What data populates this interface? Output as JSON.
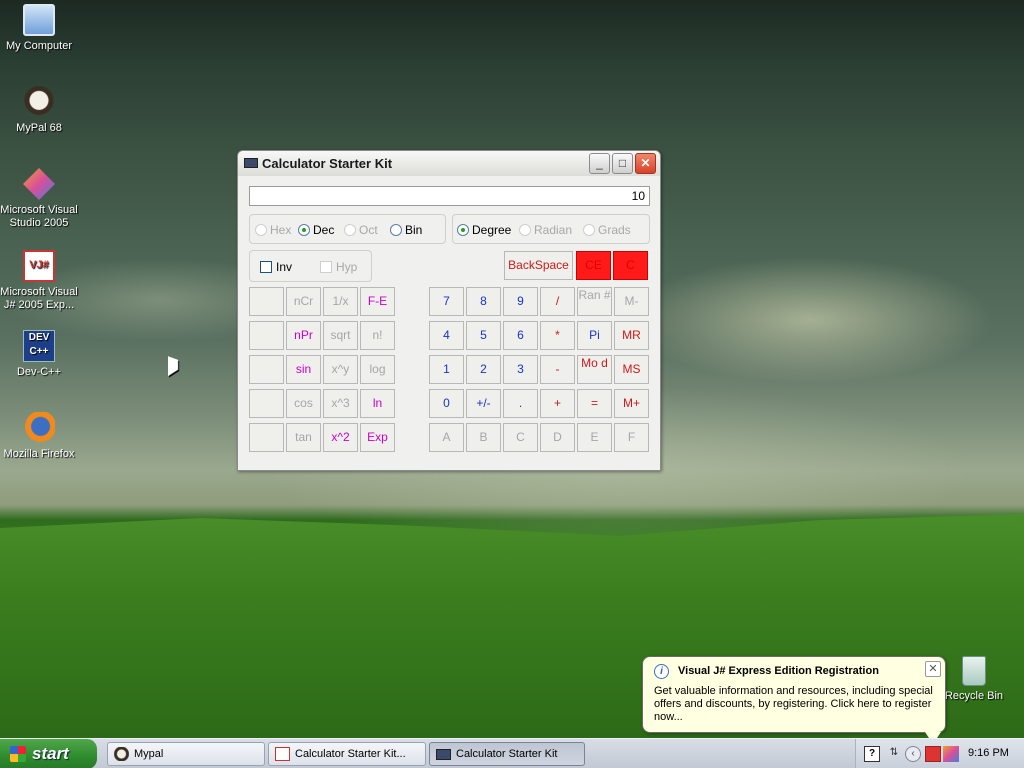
{
  "desktop": {
    "icons": [
      {
        "label": "My Computer",
        "icon": "my-computer-icon"
      },
      {
        "label": "MyPal 68",
        "icon": "mypal-icon"
      },
      {
        "label": "Microsoft Visual Studio 2005",
        "icon": "visual-studio-icon"
      },
      {
        "label": "Microsoft Visual J# 2005 Exp...",
        "icon": "visual-jsharp-icon"
      },
      {
        "label": "Dev-C++",
        "icon": "dev-cpp-icon"
      },
      {
        "label": "Mozilla Firefox",
        "icon": "firefox-icon"
      },
      {
        "label": "Recycle Bin",
        "icon": "recycle-bin-icon"
      }
    ]
  },
  "window": {
    "title": "Calculator Starter Kit",
    "display_value": "10",
    "number_base": {
      "options": [
        {
          "label": "Hex",
          "selected": false,
          "enabled": false
        },
        {
          "label": "Dec",
          "selected": true,
          "enabled": true
        },
        {
          "label": "Oct",
          "selected": false,
          "enabled": false
        },
        {
          "label": "Bin",
          "selected": false,
          "enabled": true
        }
      ]
    },
    "angle_unit": {
      "options": [
        {
          "label": "Degree",
          "selected": true,
          "enabled": true
        },
        {
          "label": "Radian",
          "selected": false,
          "enabled": false
        },
        {
          "label": "Grads",
          "selected": false,
          "enabled": false
        }
      ]
    },
    "modifiers": {
      "inv": {
        "label": "Inv",
        "checked": false,
        "enabled": true
      },
      "hyp": {
        "label": "Hyp",
        "checked": false,
        "enabled": false
      }
    },
    "control_keys": {
      "backspace": "BackSpace",
      "ce": "CE",
      "c": "C"
    },
    "sci_keys": [
      [
        "",
        "nCr",
        "1/x",
        "F-E"
      ],
      [
        "",
        "nPr",
        "sqrt",
        "n!"
      ],
      [
        "",
        "sin",
        "x^y",
        "log"
      ],
      [
        "",
        "cos",
        "x^3",
        "ln"
      ],
      [
        "",
        "tan",
        "x^2",
        "Exp"
      ]
    ],
    "num_keys": [
      [
        "7",
        "8",
        "9",
        "/",
        "Ran #",
        "M-"
      ],
      [
        "4",
        "5",
        "6",
        "*",
        "Pi",
        "MR"
      ],
      [
        "1",
        "2",
        "3",
        "-",
        "Mo d",
        "MS"
      ],
      [
        "0",
        "+/-",
        ".",
        "+",
        "=",
        "M+"
      ],
      [
        "A",
        "B",
        "C",
        "D",
        "E",
        "F"
      ]
    ],
    "colors": {
      "magenta": "#cc00cc",
      "blue": "#1a33cc",
      "red": "#cc1a1a",
      "disabled": "#a6a6a6",
      "red_key_bg": "#ff1a1a"
    }
  },
  "taskbar": {
    "start_label": "start",
    "tasks": [
      {
        "label": "Mypal",
        "active": false
      },
      {
        "label": "Calculator Starter Kit...",
        "active": false
      },
      {
        "label": "Calculator Starter Kit",
        "active": true
      }
    ],
    "clock": "9:16 PM"
  },
  "balloon": {
    "title": "Visual J# Express Edition Registration",
    "text": "Get valuable information and resources, including special offers and discounts, by registering. Click here to register now..."
  }
}
